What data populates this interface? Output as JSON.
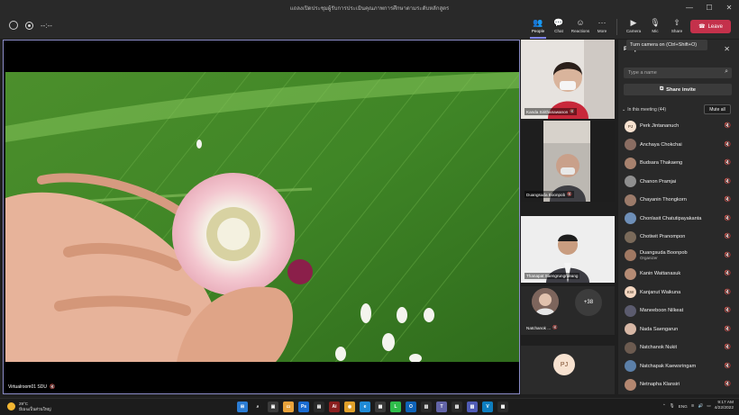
{
  "window": {
    "title": "แถลงเปิดประชุมผู้รับการประเมินคุณภาพการศึกษาตามระดับหลักสูตร",
    "min_label": "—",
    "max_label": "☐",
    "close_label": "✕"
  },
  "toolbar": {
    "timer": "--:--",
    "people_label": "People",
    "chat_label": "Chat",
    "reactions_label": "Reactions",
    "more_label": "More",
    "camera_label": "Camera",
    "mic_label": "Mic",
    "share_label": "Share",
    "leave_label": "Leave",
    "camera_tooltip": "Turn camera on (Ctrl+Shift+O)"
  },
  "stage": {
    "main_name": "Virtualroom01 SDU"
  },
  "gallery": {
    "tiles": [
      {
        "name": "Kanda Sirithanawanon"
      },
      {
        "name": "Duangsuda Boonpob"
      },
      {
        "name": "Thanapat Saengrungrueang"
      },
      {
        "name": "Natchanok ..."
      }
    ],
    "overflow_count": "+38",
    "pj_initials": "PJ"
  },
  "people_panel": {
    "title": "People",
    "search_placeholder": "Type a name",
    "share_invite_label": "Share invite",
    "in_meeting_label": "In this meeting (44)",
    "mute_all_label": "Mute all",
    "participants": [
      {
        "name": "Perk Jintananuch",
        "initials": "PJ",
        "role": "",
        "color": "#f7e2d0"
      },
      {
        "name": "Anchaya Chokchai",
        "initials": "",
        "role": "",
        "color": "#8a6d62"
      },
      {
        "name": "Budsara Thakaeng",
        "initials": "",
        "role": "",
        "color": "#a8826e"
      },
      {
        "name": "Chanon Pramjai",
        "initials": "",
        "role": "",
        "color": "#8f8f8f"
      },
      {
        "name": "Chayanin Thongkorn",
        "initials": "",
        "role": "",
        "color": "#9c7b6a"
      },
      {
        "name": "Chonlasit Chatutipayakanta",
        "initials": "",
        "role": "",
        "color": "#6e8fb8"
      },
      {
        "name": "Chotiwit Pranompon",
        "initials": "",
        "role": "",
        "color": "#7a6a5a"
      },
      {
        "name": "Duangsuda Boonpob",
        "initials": "",
        "role": "Organizer",
        "color": "#a07862"
      },
      {
        "name": "Kanin Wattanasuk",
        "initials": "",
        "role": "",
        "color": "#b58b74"
      },
      {
        "name": "Kanjanut Waikuna",
        "initials": "KW",
        "role": "",
        "color": "#f3d6c0"
      },
      {
        "name": "Maneeboon Nilkeat",
        "initials": "",
        "role": "",
        "color": "#5b5b6e"
      },
      {
        "name": "Nada Saengarun",
        "initials": "",
        "role": "",
        "color": "#d7b7a5"
      },
      {
        "name": "Natchanok Nukit",
        "initials": "",
        "role": "",
        "color": "#6c5b50"
      },
      {
        "name": "Natchapak Kaewsringam",
        "initials": "",
        "role": "",
        "color": "#5b7fa8"
      },
      {
        "name": "Netnapha Klansiri",
        "initials": "",
        "role": "",
        "color": "#b48770"
      }
    ]
  },
  "taskbar": {
    "temperature": "29°C",
    "weather_desc": "มีเมฆเป็นส่วนใหญ่",
    "lang": "ENG",
    "time": "9:17 AM",
    "date": "4/22/2022"
  }
}
